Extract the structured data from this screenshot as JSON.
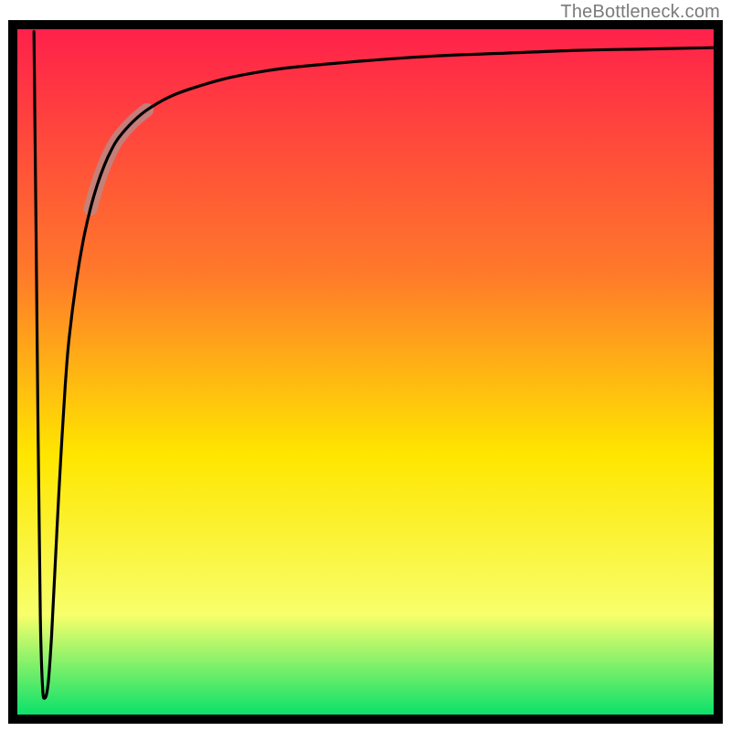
{
  "attribution": "TheBottleneck.com",
  "colors": {
    "grad_top": "#ff1f4b",
    "grad_mid1": "#ff7a2a",
    "grad_mid2": "#ffe600",
    "grad_mid3": "#f7ff6b",
    "grad_bottom": "#00e06a",
    "frame": "#000000",
    "curve": "#000000",
    "fuzzy": "#b88a88"
  },
  "chart_data": {
    "type": "line",
    "title": "",
    "xlabel": "",
    "ylabel": "",
    "xlim": [
      0,
      100
    ],
    "ylim": [
      0,
      100
    ],
    "series": [
      {
        "name": "curve",
        "x": [
          3.0,
          3.3,
          3.6,
          3.9,
          4.2,
          4.5,
          5.0,
          5.5,
          6.0,
          6.5,
          7.0,
          7.5,
          8.0,
          9.0,
          10.0,
          11.0,
          12.0,
          13.0,
          14.0,
          15.0,
          17.0,
          19.0,
          22.0,
          25.0,
          30.0,
          35.0,
          40.0,
          50.0,
          60.0,
          70.0,
          80.0,
          90.0,
          100.0
        ],
        "y": [
          99.0,
          70.0,
          40.0,
          15.0,
          5.0,
          3.0,
          5.0,
          12.0,
          22.0,
          32.0,
          41.0,
          49.0,
          55.0,
          63.0,
          69.0,
          73.5,
          77.0,
          79.8,
          82.0,
          83.7,
          86.0,
          87.7,
          89.5,
          90.7,
          92.2,
          93.2,
          93.9,
          94.8,
          95.5,
          95.9,
          96.3,
          96.5,
          96.7
        ]
      }
    ],
    "fuzzy_segment": {
      "x_range": [
        12.0,
        17.0
      ]
    }
  }
}
